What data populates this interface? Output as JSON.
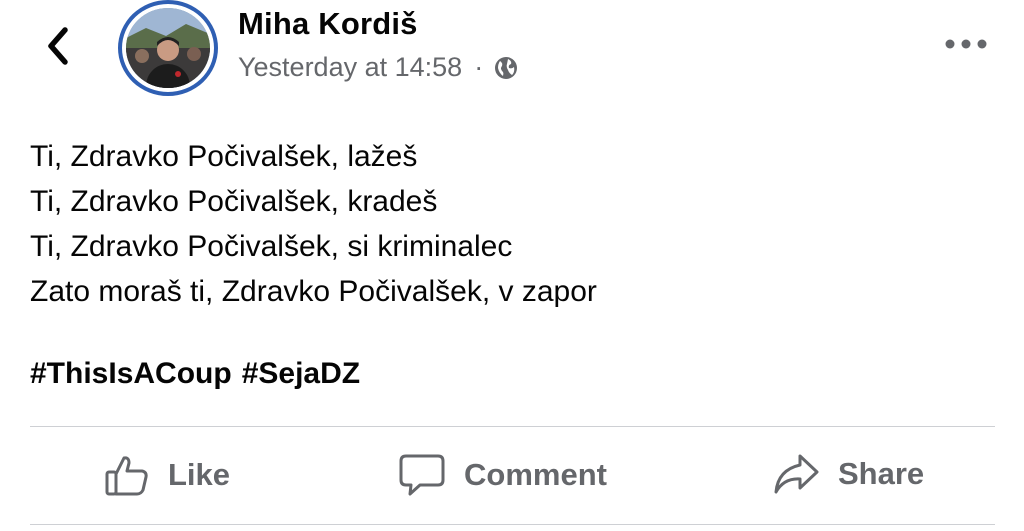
{
  "post": {
    "author_name": "Miha Kordiš",
    "timestamp": "Yesterday at 14:58",
    "separator": "·",
    "audience_icon": "globe-icon",
    "body_lines": [
      "Ti, Zdravko Počivalšek, lažeš",
      "Ti, Zdravko Počivalšek, kradeš",
      "Ti, Zdravko Počivalšek, si kriminalec",
      "Zato moraš ti, Zdravko Počivalšek, v zapor"
    ],
    "hashtags": [
      "#ThisIsACoup",
      "#SejaDZ"
    ]
  },
  "actions": {
    "like_label": "Like",
    "comment_label": "Comment",
    "share_label": "Share"
  },
  "icons": {
    "back": "chevron-left-icon",
    "more": "more-horizontal-icon",
    "like": "thumbs-up-icon",
    "comment": "comment-bubble-icon",
    "share": "share-arrow-icon"
  },
  "colors": {
    "avatar_ring": "#2f5fb3",
    "secondary_text": "#65676b",
    "divider": "#ced0d4"
  }
}
